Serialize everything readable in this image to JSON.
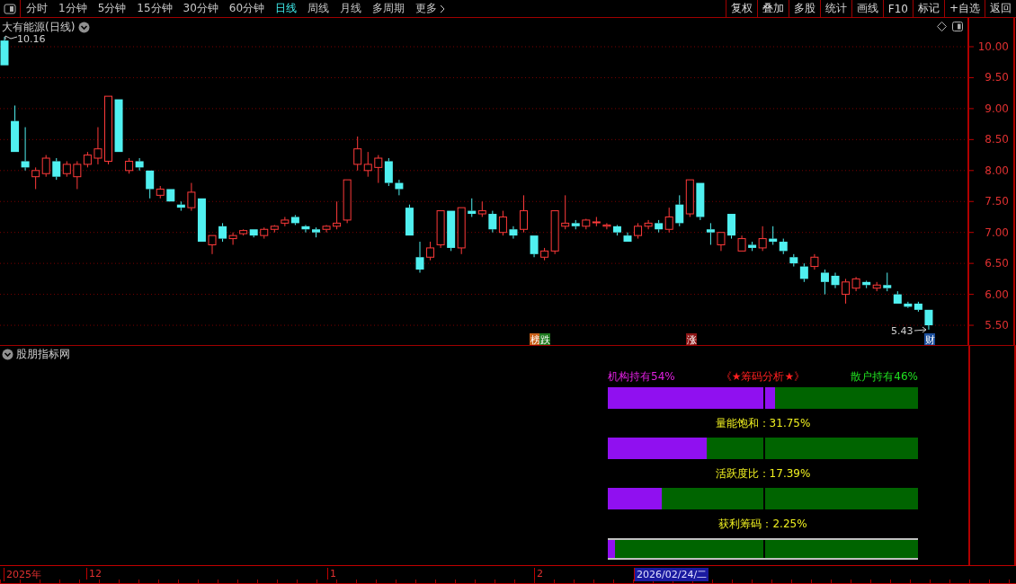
{
  "toolbar": {
    "tabs": [
      {
        "label": "分时",
        "selected": false
      },
      {
        "label": "1分钟",
        "selected": false
      },
      {
        "label": "5分钟",
        "selected": false
      },
      {
        "label": "15分钟",
        "selected": false
      },
      {
        "label": "30分钟",
        "selected": false
      },
      {
        "label": "60分钟",
        "selected": false
      },
      {
        "label": "日线",
        "selected": true
      },
      {
        "label": "周线",
        "selected": false
      },
      {
        "label": "月线",
        "selected": false
      },
      {
        "label": "多周期",
        "selected": false
      },
      {
        "label": "更多",
        "selected": false
      }
    ],
    "buttons": [
      "复权",
      "叠加",
      "多股",
      "统计",
      "画线",
      "F10",
      "标记",
      "+自选",
      "返回"
    ]
  },
  "chart": {
    "title": "大有能源(日线)",
    "high_label": "10.16",
    "low_label": "5.43",
    "price_ticks": [
      "10.00",
      "9.50",
      "9.00",
      "8.50",
      "8.00",
      "7.50",
      "7.00",
      "6.50",
      "6.00",
      "5.50"
    ],
    "event_tags": [
      {
        "label": "榜",
        "color": "#c8601a"
      },
      {
        "label": "跌",
        "color": "#1f7a1f"
      },
      {
        "label": "涨",
        "color": "#8c1414"
      },
      {
        "label": "财",
        "color": "#1c4f9c"
      }
    ]
  },
  "indicator": {
    "title": "股朋指标网",
    "headers": [
      {
        "text": "机构持有54%",
        "color": "#e020e0"
      },
      {
        "text": "《★筹码分析★》",
        "color": "#ff2020"
      },
      {
        "text": "散户持有46%",
        "color": "#20e020"
      }
    ],
    "bars": [
      {
        "level": 0.54
      },
      {
        "label": "量能饱和：31.75%",
        "level": 0.3175
      },
      {
        "label": "活跃度比：17.39%",
        "level": 0.1739
      },
      {
        "label": "获利筹码：2.25%",
        "level": 0.0225
      }
    ]
  },
  "time_axis": [
    {
      "label": "2025年",
      "selected": false
    },
    {
      "label": "12",
      "selected": false
    },
    {
      "label": "1",
      "selected": false
    },
    {
      "label": "2",
      "selected": false
    },
    {
      "label": "2026/02/24/二",
      "selected": true
    }
  ]
}
